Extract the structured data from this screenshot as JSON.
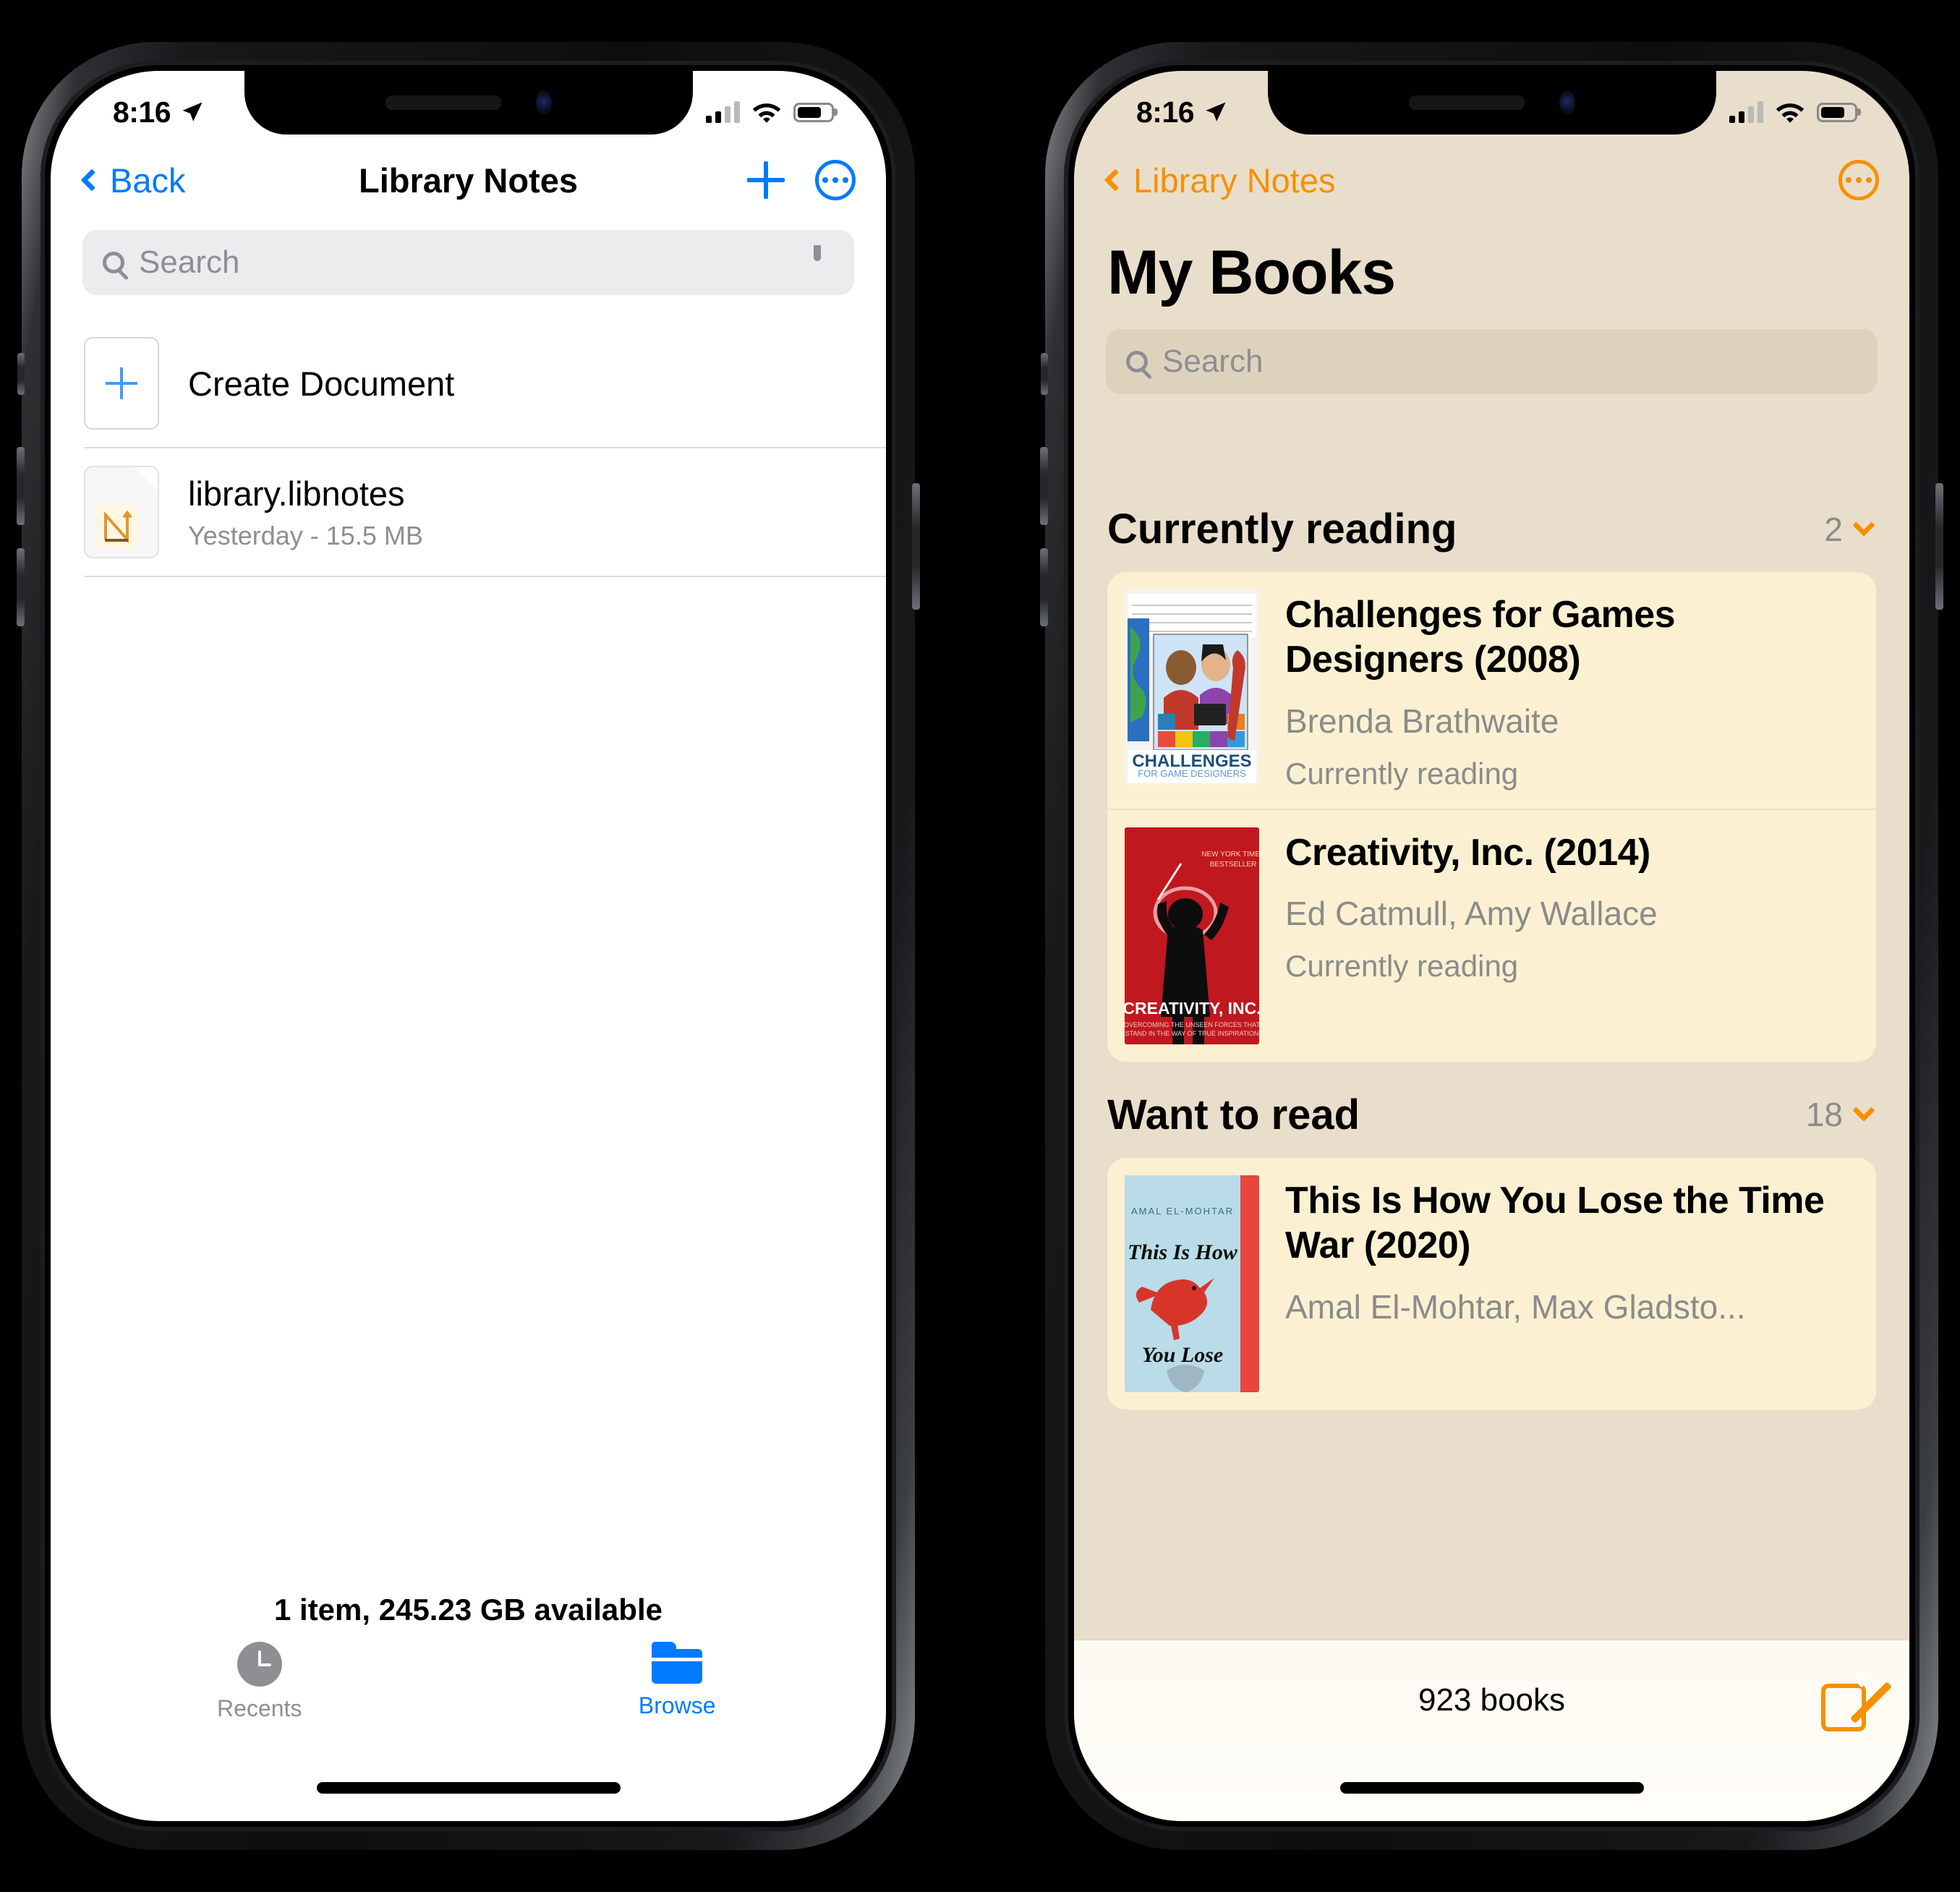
{
  "status_bar": {
    "time": "8:16",
    "location_icon": "location-arrow-icon",
    "cellular_icon": "cellular-signal-icon",
    "wifi_icon": "wifi-icon",
    "battery_icon": "battery-icon"
  },
  "files_app": {
    "nav": {
      "back_label": "Back",
      "title": "Library Notes",
      "add_icon": "plus-icon",
      "more_icon": "more-circle-icon"
    },
    "search": {
      "placeholder": "Search",
      "search_icon": "search-icon",
      "mic_icon": "microphone-icon"
    },
    "rows": [
      {
        "label": "Create Document",
        "icon": "new-document-icon",
        "sub": ""
      },
      {
        "label": "library.libnotes",
        "icon": "libnotes-file-icon",
        "sub": "Yesterday - 15.5 MB"
      }
    ],
    "footer_status": "1 item, 245.23 GB available",
    "tabs": [
      {
        "label": "Recents",
        "icon": "clock-icon",
        "active": false
      },
      {
        "label": "Browse",
        "icon": "folder-icon",
        "active": true
      }
    ]
  },
  "books_app": {
    "nav": {
      "back_label": "Library Notes",
      "more_icon": "more-circle-icon"
    },
    "title": "My Books",
    "search": {
      "placeholder": "Search",
      "search_icon": "search-icon"
    },
    "sections": [
      {
        "title": "Currently reading",
        "count": "2",
        "chevron_icon": "chevron-down-icon",
        "books": [
          {
            "title": "Challenges for Games Designers (2008)",
            "author": "Brenda Brathwaite",
            "status": "Currently reading",
            "cover_icon": "book-cover-challenges"
          },
          {
            "title": "Creativity, Inc. (2014)",
            "author": "Ed Catmull, Amy Wallace",
            "status": "Currently reading",
            "cover_icon": "book-cover-creativity"
          }
        ]
      },
      {
        "title": "Want to read",
        "count": "18",
        "chevron_icon": "chevron-down-icon",
        "books": [
          {
            "title": "This Is How You Lose the Time War (2020)",
            "author": "Amal El-Mohtar, Max Gladsto...",
            "status": "",
            "cover_icon": "book-cover-timewar"
          }
        ]
      }
    ],
    "bottom_bar": {
      "count_label": "923 books",
      "compose_icon": "compose-icon"
    }
  },
  "colors": {
    "ios_blue": "#007aff",
    "books_orange": "#f59000",
    "cream_bg": "#e9decb",
    "card_bg": "#fbf1d2",
    "muted_text": "#8e8e93"
  }
}
